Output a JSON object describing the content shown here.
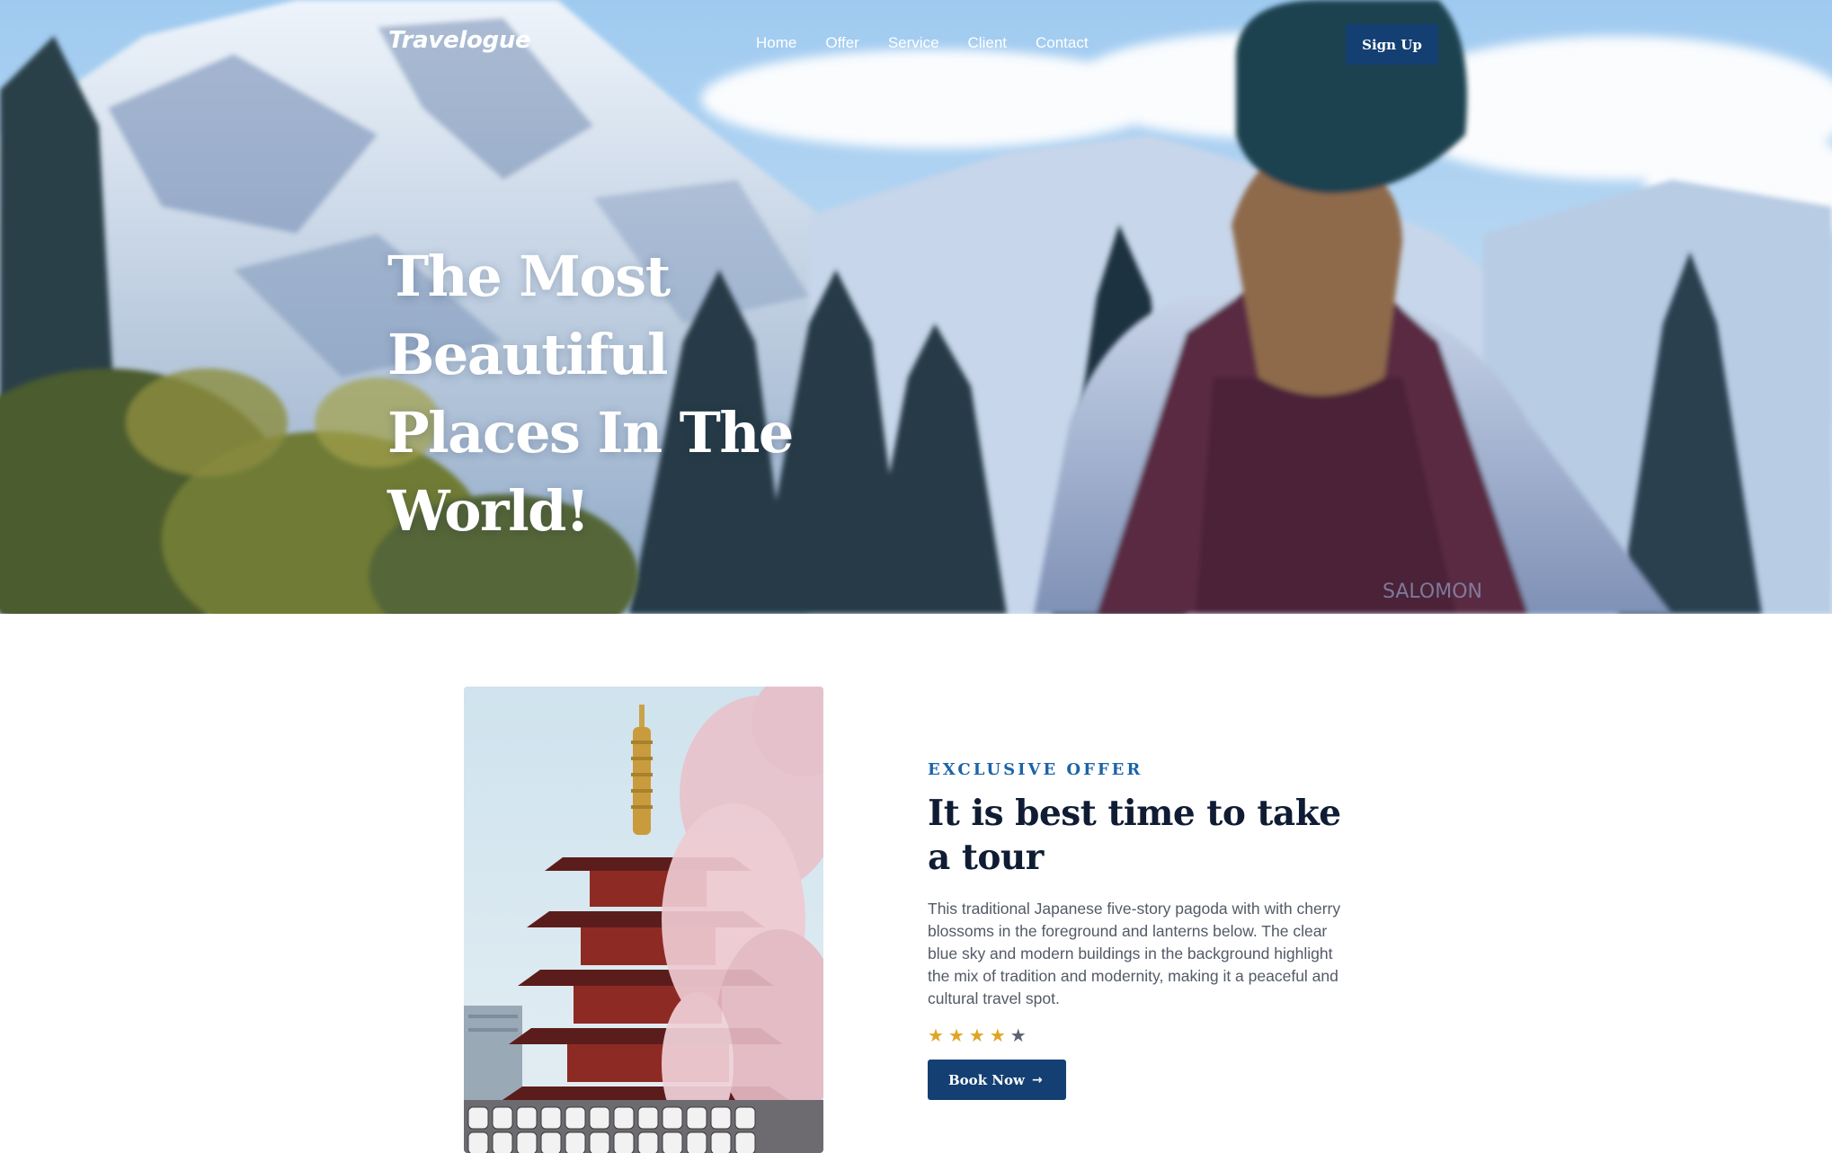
{
  "brand": {
    "name": "Travelogue"
  },
  "nav": {
    "items": [
      {
        "label": "Home"
      },
      {
        "label": "Offer"
      },
      {
        "label": "Service"
      },
      {
        "label": "Client"
      },
      {
        "label": "Contact"
      }
    ],
    "signup_label": "Sign Up"
  },
  "hero": {
    "title_lines": [
      "The Most Beautiful",
      "Places In The",
      "World!"
    ],
    "backpack_logo": "SALOMON"
  },
  "offer": {
    "eyebrow": "EXCLUSIVE OFFER",
    "heading": "It is best time to take a tour",
    "description": "This traditional Japanese five-story pagoda with with cherry blossoms in the foreground and lanterns below. The clear blue sky and modern buildings in the background highlight the mix of tradition and modernity, making it a peaceful and cultural travel spot.",
    "rating": {
      "value": 4,
      "max": 5
    },
    "button_label": "Book Now",
    "button_icon": "arrow-right-icon"
  },
  "colors": {
    "primary_button": "#133f73",
    "eyebrow": "#1d64a8",
    "heading": "#0f1c33",
    "star_filled": "#e0a425",
    "star_empty": "#5a6272"
  }
}
